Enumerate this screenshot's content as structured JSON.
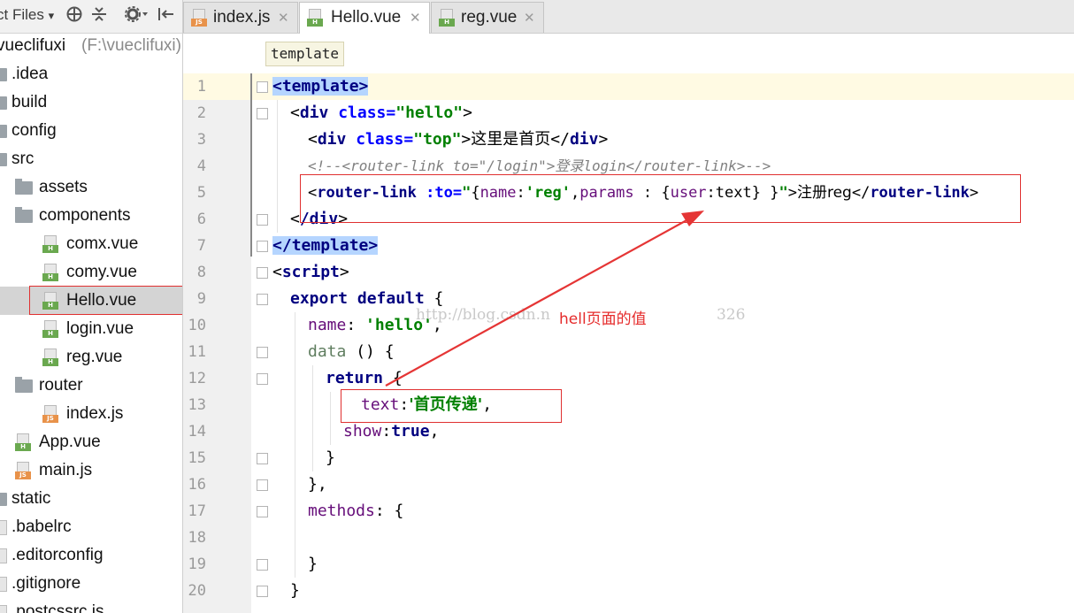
{
  "project_panel": {
    "toolbar_label": "ct Files",
    "dropdown_glyph": "▾",
    "icons": [
      "target-icon",
      "collapse-icon",
      "gear-icon",
      "hide-panel-icon"
    ],
    "root": {
      "name": "vueclifuxi",
      "path": "(F:\\vueclifuxi)"
    },
    "items": [
      {
        "label": ".idea",
        "kind": "folder"
      },
      {
        "label": "build",
        "kind": "folder"
      },
      {
        "label": "config",
        "kind": "folder"
      },
      {
        "label": "src",
        "kind": "folder"
      },
      {
        "label": "assets",
        "kind": "folder"
      },
      {
        "label": "components",
        "kind": "folder"
      },
      {
        "label": "comx.vue",
        "kind": "vue"
      },
      {
        "label": "comy.vue",
        "kind": "vue"
      },
      {
        "label": "Hello.vue",
        "kind": "vue",
        "selected": true
      },
      {
        "label": "login.vue",
        "kind": "vue"
      },
      {
        "label": "reg.vue",
        "kind": "vue"
      },
      {
        "label": "router",
        "kind": "folder"
      },
      {
        "label": "index.js",
        "kind": "js"
      },
      {
        "label": "App.vue",
        "kind": "vue"
      },
      {
        "label": "main.js",
        "kind": "js"
      },
      {
        "label": "static",
        "kind": "folder"
      },
      {
        "label": ".babelrc",
        "kind": "json"
      },
      {
        "label": ".editorconfig",
        "kind": "file"
      },
      {
        "label": ".gitignore",
        "kind": "file"
      },
      {
        "label": ".postcssrc.js",
        "kind": "js"
      }
    ]
  },
  "tabs": [
    {
      "label": "index.js",
      "kind": "js",
      "active": false
    },
    {
      "label": "Hello.vue",
      "kind": "vue",
      "active": true
    },
    {
      "label": "reg.vue",
      "kind": "vue",
      "active": false
    }
  ],
  "tab_close_glyph": "✕",
  "file_badges": {
    "vue": "H",
    "js": "JS"
  },
  "breadcrumb": "template",
  "line_numbers": [
    "1",
    "2",
    "3",
    "4",
    "5",
    "6",
    "7",
    "8",
    "9",
    "10",
    "11",
    "12",
    "13",
    "14",
    "15",
    "16",
    "17",
    "18",
    "19",
    "20"
  ],
  "code": {
    "l1": [
      "<",
      "template",
      ">"
    ],
    "l2": [
      "<",
      "div",
      " ",
      "class",
      "=",
      "\"hello\"",
      ">"
    ],
    "l3": [
      "<",
      "div",
      " ",
      "class",
      "=",
      "\"top\"",
      ">",
      "这里是首页",
      "</",
      "div",
      ">"
    ],
    "l4": "<!--<router-link to=\"/login\">登录login</router-link>-->",
    "l5": [
      "<",
      "router-link",
      " ",
      ":to",
      "=",
      "\"",
      "{",
      "name",
      ":",
      "'reg'",
      ",",
      "params",
      " : ",
      "{",
      "user",
      ":text",
      "} }",
      "\"",
      ">",
      "注册reg",
      "</",
      "router-link",
      ">"
    ],
    "l6": [
      "<",
      "/div",
      ">"
    ],
    "l7": [
      "</",
      "template",
      ">"
    ],
    "l8": [
      "<",
      "script",
      ">"
    ],
    "l9": [
      "export default",
      " {"
    ],
    "l10": [
      "name",
      ": ",
      "'hello'",
      ","
    ],
    "l11": [
      "data",
      " () {"
    ],
    "l12": [
      "return",
      " {"
    ],
    "l13": [
      "text",
      ":",
      "'首页传递'",
      ","
    ],
    "l14": [
      "show",
      ":",
      "true",
      ","
    ],
    "l15": "}",
    "l16": "},",
    "l17": [
      "methods",
      ": {"
    ],
    "l19": "}",
    "l20": "}"
  },
  "annotation": {
    "text": "hell页面的值",
    "color": "#e52b2b"
  },
  "watermark": "http://blog.csdn.n",
  "watermark_tail": "326",
  "colors": {
    "tag": "#000080",
    "attribute": "#0000ff",
    "string": "#008000",
    "comment": "#808080",
    "highlight": "#b5d5ff",
    "current_line": "#fffae3",
    "annotation_red": "#e03030"
  }
}
